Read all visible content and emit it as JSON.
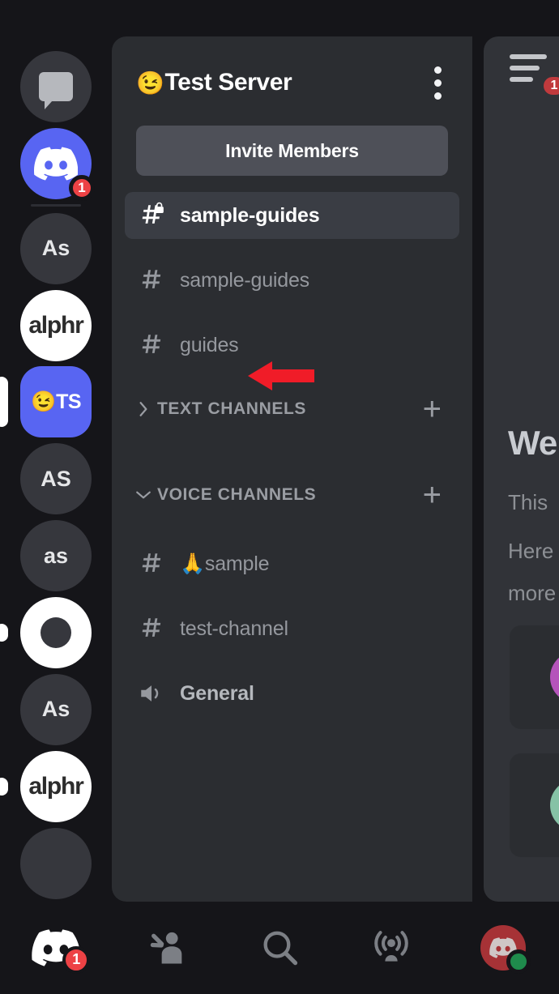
{
  "server_rail": {
    "items": [
      {
        "name": "home-dms",
        "type": "home",
        "label": "",
        "style": "grey",
        "badge": null,
        "selected": false
      },
      {
        "name": "discord-server",
        "type": "discord-logo",
        "label": "",
        "style": "blurple",
        "badge": "1",
        "selected": false
      },
      {
        "name": "server-as-1",
        "type": "text",
        "label": "As",
        "style": "grey",
        "badge": null,
        "selected": false
      },
      {
        "name": "server-alphr-1",
        "type": "alphr",
        "label": "alphr",
        "style": "white",
        "badge": null,
        "selected": false
      },
      {
        "name": "server-test-server",
        "type": "emoji-text",
        "label": "TS",
        "emoji": "😉",
        "style": "blurple",
        "badge": null,
        "selected": true
      },
      {
        "name": "server-AS",
        "type": "text",
        "label": "AS",
        "style": "grey",
        "badge": null,
        "selected": false
      },
      {
        "name": "server-as-2",
        "type": "text",
        "label": "as",
        "style": "grey",
        "badge": null,
        "selected": false
      },
      {
        "name": "server-ring",
        "type": "ring",
        "label": "",
        "style": "dark",
        "badge": null,
        "selected": true
      },
      {
        "name": "server-as-3",
        "type": "text",
        "label": "As",
        "style": "grey",
        "badge": null,
        "selected": false
      },
      {
        "name": "server-alphr-2",
        "type": "alphr",
        "label": "alphr",
        "style": "white",
        "badge": null,
        "selected": true
      }
    ]
  },
  "channel_panel": {
    "server_emoji": "😉",
    "server_name": "Test Server",
    "kebab_menu": "more-options",
    "invite_label": "Invite Members",
    "channels_top": [
      {
        "name": "sample-guides",
        "icon": "hash-locked-icon",
        "active": true
      },
      {
        "name": "sample-guides",
        "icon": "hash-icon",
        "active": false
      },
      {
        "name": "guides",
        "icon": "hash-icon",
        "active": false
      }
    ],
    "categories": [
      {
        "label": "TEXT CHANNELS",
        "expanded": false,
        "add_label": "+"
      },
      {
        "label": "VOICE CHANNELS",
        "expanded": true,
        "add_label": "+"
      }
    ],
    "channels_voice_group": [
      {
        "name": "🙏sample",
        "emoji": "🙏",
        "text": "sample",
        "icon": "hash-icon"
      },
      {
        "name": "test-channel",
        "emoji": "",
        "text": "test-channel",
        "icon": "hash-icon"
      },
      {
        "name": "General",
        "emoji": "",
        "text": "General",
        "icon": "speaker-icon"
      }
    ]
  },
  "content_panel": {
    "hamburger_badge": "1",
    "welcome_heading": "We",
    "line1": "This",
    "line2": "Here",
    "line3": "more"
  },
  "bottom_nav": {
    "items": [
      {
        "name": "nav-servers",
        "icon": "discord-logo-icon",
        "badge": "1",
        "active": true
      },
      {
        "name": "nav-friends",
        "icon": "person-wave-icon",
        "badge": null,
        "active": false
      },
      {
        "name": "nav-search",
        "icon": "search-icon",
        "badge": null,
        "active": false
      },
      {
        "name": "nav-mentions",
        "icon": "broadcast-icon",
        "badge": null,
        "active": false
      },
      {
        "name": "nav-profile",
        "icon": "avatar-icon",
        "badge": null,
        "active": false,
        "status": "online"
      }
    ]
  },
  "annotation": {
    "arrow": "red-left-arrow",
    "color": "#f01c28",
    "points_at": "guides"
  },
  "colors": {
    "app_bg": "#151519",
    "panel_bg": "#2b2d31",
    "content_bg": "#313338",
    "active_channel": "#3a3d44",
    "invite_button": "#4e5058",
    "blurple": "#5865f2",
    "badge_red": "#ed4245",
    "online_green": "#1f8b4c",
    "muted_text": "#95989e",
    "white": "#ffffff"
  }
}
